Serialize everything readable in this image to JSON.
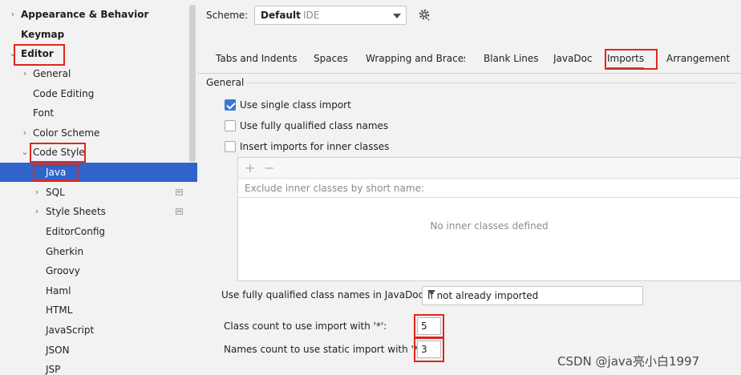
{
  "sidebar": {
    "items": [
      {
        "label": "Appearance & Behavior",
        "chevron": "›",
        "bold": true
      },
      {
        "label": "Keymap",
        "chevron": "",
        "bold": true
      },
      {
        "label": "Editor",
        "chevron": "⌄",
        "bold": true
      },
      {
        "label": "General",
        "chevron": "›"
      },
      {
        "label": "Code Editing",
        "chevron": ""
      },
      {
        "label": "Font",
        "chevron": ""
      },
      {
        "label": "Color Scheme",
        "chevron": "›"
      },
      {
        "label": "Code Style",
        "chevron": "⌄"
      },
      {
        "label": "Java",
        "chevron": "",
        "selected": true
      },
      {
        "label": "SQL",
        "chevron": "›"
      },
      {
        "label": "Style Sheets",
        "chevron": "›"
      },
      {
        "label": "EditorConfig",
        "chevron": ""
      },
      {
        "label": "Gherkin",
        "chevron": ""
      },
      {
        "label": "Groovy",
        "chevron": ""
      },
      {
        "label": "Haml",
        "chevron": ""
      },
      {
        "label": "HTML",
        "chevron": ""
      },
      {
        "label": "JavaScript",
        "chevron": ""
      },
      {
        "label": "JSON",
        "chevron": ""
      },
      {
        "label": "JSP",
        "chevron": ""
      }
    ]
  },
  "scheme": {
    "label": "Scheme:",
    "name": "Default",
    "kind": "IDE",
    "gear_icon": "gear-icon"
  },
  "tabs": [
    {
      "label": "Tabs and Indents"
    },
    {
      "label": "Spaces"
    },
    {
      "label": "Wrapping and Braces"
    },
    {
      "label": "Blank Lines"
    },
    {
      "label": "JavaDoc"
    },
    {
      "label": "Imports",
      "active": true
    },
    {
      "label": "Arrangement"
    }
  ],
  "general": {
    "title": "General",
    "checkboxes": [
      {
        "label": "Use single class import",
        "checked": true
      },
      {
        "label": "Use fully qualified class names",
        "checked": false
      },
      {
        "label": "Insert imports for inner classes",
        "checked": false
      }
    ],
    "list": {
      "add_icon": "+",
      "remove_icon": "−",
      "header": "Exclude inner classes by short name:",
      "empty_text": "No inner classes defined"
    },
    "javadoc": {
      "label": "Use fully qualified class names in JavaDoc:",
      "value": "If not already imported"
    },
    "class_count": {
      "label": "Class count to use import with '*':",
      "value": "5"
    },
    "names_count": {
      "label": "Names count to use static import with '*':",
      "value": "3"
    }
  },
  "watermark": "CSDN @java亮小白1997",
  "colors": {
    "accent": "#3b78d6",
    "selection": "#2f65ca",
    "highlight_box": "#e0261b"
  }
}
